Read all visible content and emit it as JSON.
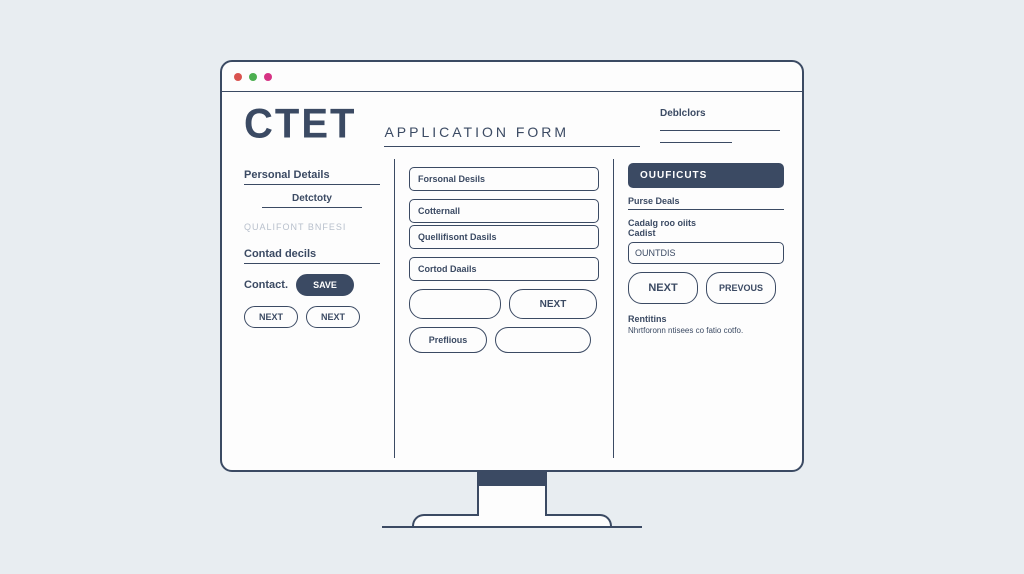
{
  "brand": "CTET",
  "page_title": "APPLICATION FORM",
  "corner": {
    "label": "Deblclors"
  },
  "left": {
    "section1": "Personal Details",
    "sub": "Detctoty",
    "faint": "QUALIFONT BNFESI",
    "section2": "Contad decils",
    "contact_label": "Contact.",
    "save": "SAVE",
    "next1": "NEXT",
    "next2": "NEXT"
  },
  "mid": {
    "f1": "Forsonal Desils",
    "f2": "Cotternall",
    "f3": "Quellifisont Dasils",
    "f4": "Cortod Daails",
    "next": "NEXT",
    "prev": "Preflious"
  },
  "right": {
    "tag": "OUUFICUTS",
    "t1": "Purse Deals",
    "t2": "Cadalg roo oiits",
    "t3": "Cadist",
    "input": "OUNTDIS",
    "next": "NEXT",
    "prev": "PREVOUS",
    "note_head": "Rentitins",
    "note": "Nhrtforonn ntisees co fatio cotfo."
  }
}
